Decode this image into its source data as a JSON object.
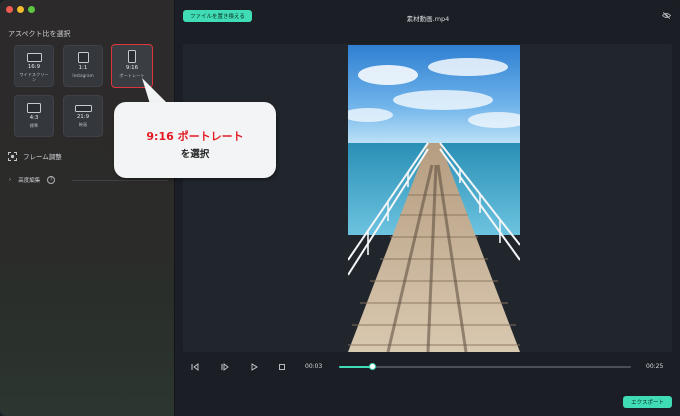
{
  "sidebar": {
    "section_title": "アスペクト比を選択",
    "ratios": [
      {
        "label": "16:9",
        "sub1": "ワイドスクリー",
        "sub2": "ン"
      },
      {
        "label": "1:1",
        "sub1": "Instagram",
        "sub2": ""
      },
      {
        "label": "9:16",
        "sub1": "ポートレート",
        "sub2": ""
      },
      {
        "label": "4:3",
        "sub1": "標準",
        "sub2": ""
      },
      {
        "label": "21:9",
        "sub1": "映画",
        "sub2": ""
      }
    ],
    "selected": "9:16",
    "frame_adjust_label": "フレーム調整",
    "advanced_label": "高度編集",
    "help_glyph": "?",
    "expand_glyph": "›"
  },
  "topbar": {
    "replace_button": "ファイルを置き換える",
    "file_title": "素材動画.mp4",
    "visibility_icon": "eye-off-icon"
  },
  "playback": {
    "current_time": "00:03",
    "total_time": "00:25",
    "progress": 0.116
  },
  "export_button": "エクスポート",
  "callout": {
    "line1": "9:16 ポートレート",
    "line2": "を選択"
  },
  "colors": {
    "accent": "#3fdcb5",
    "selected_border": "#e0343e",
    "callout_red": "#e31b23"
  }
}
